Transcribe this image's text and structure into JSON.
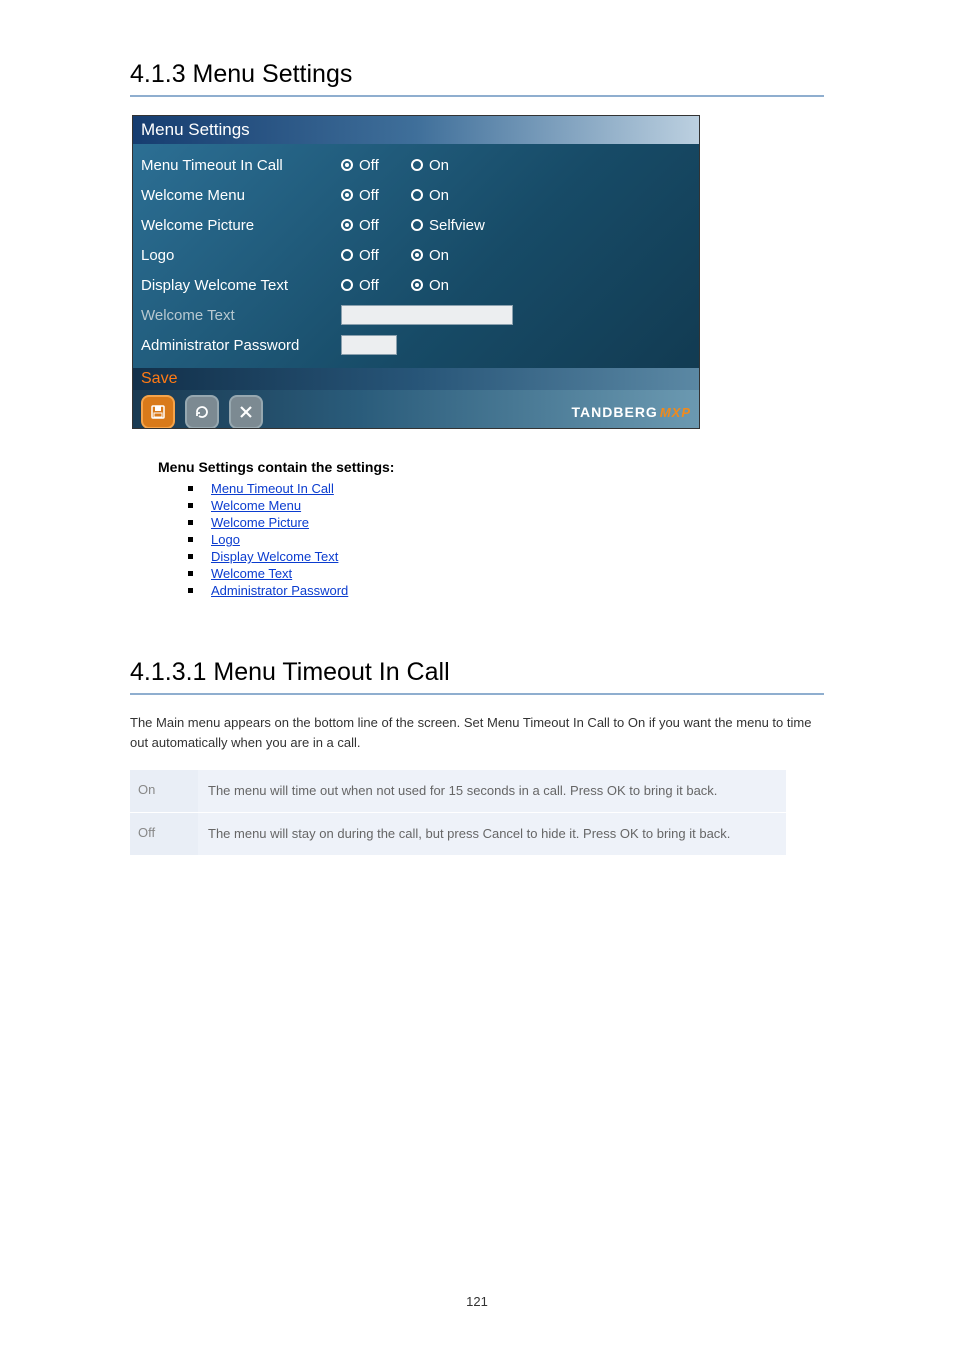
{
  "section1": {
    "heading": "4.1.3 Menu Settings"
  },
  "menu_shot": {
    "title": "Menu Settings",
    "rows": [
      {
        "label": "Menu Timeout In Call",
        "opts": [
          "Off",
          "On"
        ],
        "selected": 0
      },
      {
        "label": "Welcome Menu",
        "opts": [
          "Off",
          "On"
        ],
        "selected": 0
      },
      {
        "label": "Welcome Picture",
        "opts": [
          "Off",
          "Selfview"
        ],
        "selected": 1
      },
      {
        "label": "Logo",
        "opts": [
          "Off",
          "On"
        ],
        "selected": 1
      },
      {
        "label": "Display Welcome Text",
        "opts": [
          "Off",
          "On"
        ],
        "selected": 1
      }
    ],
    "welcome_text_label": "Welcome Text",
    "admin_pw_label": "Administrator Password",
    "save_label": "Save",
    "brand": {
      "name": "TANDBERG",
      "suffix": "MXP"
    }
  },
  "links": {
    "heading": "Menu Settings contain the settings:",
    "items": [
      "Menu Timeout In Call",
      "Welcome Menu",
      "Welcome Picture",
      "Logo",
      "Display Welcome Text",
      "Welcome Text",
      "Administrator Password"
    ]
  },
  "section2": {
    "heading": "4.1.3.1 Menu Timeout In Call",
    "body": "The Main menu appears on the bottom line of the screen. Set Menu Timeout In Call to On if you want the menu to time out automatically when you are in a call."
  },
  "table": {
    "rows": [
      {
        "key": "On",
        "val": "The menu will time out when not used for 15 seconds in a call. Press OK to bring it back."
      },
      {
        "key": "Off",
        "val": "The menu will stay on during the call, but press Cancel to hide it. Press OK to bring it back."
      }
    ]
  },
  "page_footer": "121"
}
